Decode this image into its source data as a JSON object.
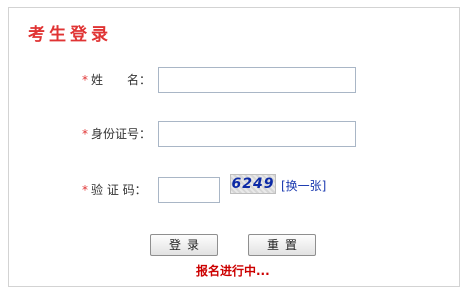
{
  "title": "考生登录",
  "form": {
    "required_mark": "*",
    "name_label": "姓　　名：",
    "id_label": "身份证号：",
    "code_label": "验 证 码：",
    "name_value": "",
    "id_value": "",
    "code_value": ""
  },
  "captcha": {
    "text": "6249",
    "change_link": "[换一张]"
  },
  "buttons": {
    "login": "登录",
    "reset": "重置"
  },
  "status": "报名进行中..."
}
